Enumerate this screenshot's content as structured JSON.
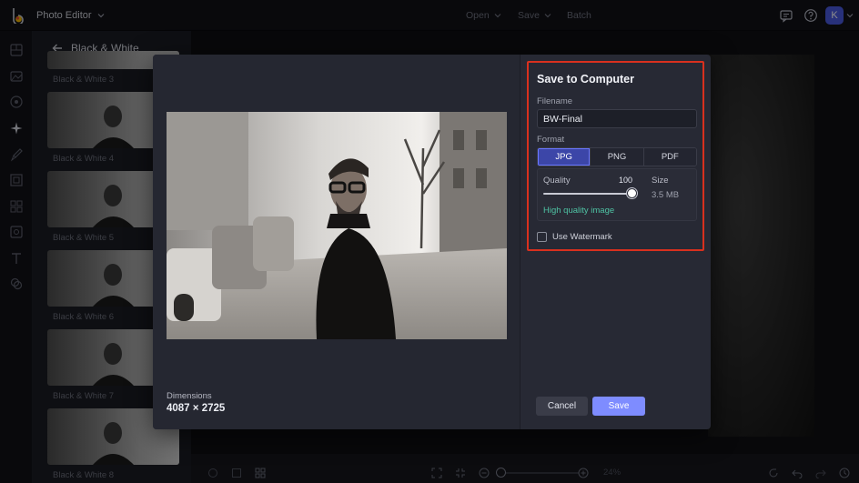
{
  "app": {
    "title": "Photo Editor",
    "avatar_initial": "K"
  },
  "topbar": {
    "menus": [
      {
        "label": "Open",
        "has_dropdown": true
      },
      {
        "label": "Save",
        "has_dropdown": true
      },
      {
        "label": "Batch",
        "has_dropdown": false
      }
    ],
    "icons": [
      "chat-icon",
      "help-icon"
    ]
  },
  "rail": {
    "icons": [
      "grid-icon",
      "adjust-icon",
      "eye-icon",
      "effects-icon",
      "brush-icon",
      "frames-icon",
      "overlays-icon",
      "graphics-icon",
      "text-icon",
      "layers-icon"
    ]
  },
  "panel": {
    "title": "Black & White",
    "items": [
      {
        "label": "Black & White 3"
      },
      {
        "label": "Black & White 4"
      },
      {
        "label": "Black & White 5"
      },
      {
        "label": "Black & White 6"
      },
      {
        "label": "Black & White 7"
      },
      {
        "label": "Black & White 8"
      }
    ]
  },
  "bottombar": {
    "zoom": "24%"
  },
  "dialog": {
    "title": "Save to Computer",
    "filename_label": "Filename",
    "filename_value": "BW-Final",
    "format_label": "Format",
    "formats": [
      "JPG",
      "PNG",
      "PDF"
    ],
    "selected_format": "JPG",
    "quality_label": "Quality",
    "quality_value": "100",
    "quality_fraction": 1.0,
    "size_label": "Size",
    "size_value": "3.5 MB",
    "quality_note": "High quality image",
    "watermark_label": "Use Watermark",
    "watermark_checked": false,
    "dimensions_label": "Dimensions",
    "dimensions_value": "4087 × 2725",
    "cancel_label": "Cancel",
    "save_label": "Save"
  },
  "colors": {
    "accent": "#7e8cff",
    "selected_format": "#3c46a8",
    "highlight_border": "#d9301e",
    "quality_note": "#4fc3a4"
  }
}
